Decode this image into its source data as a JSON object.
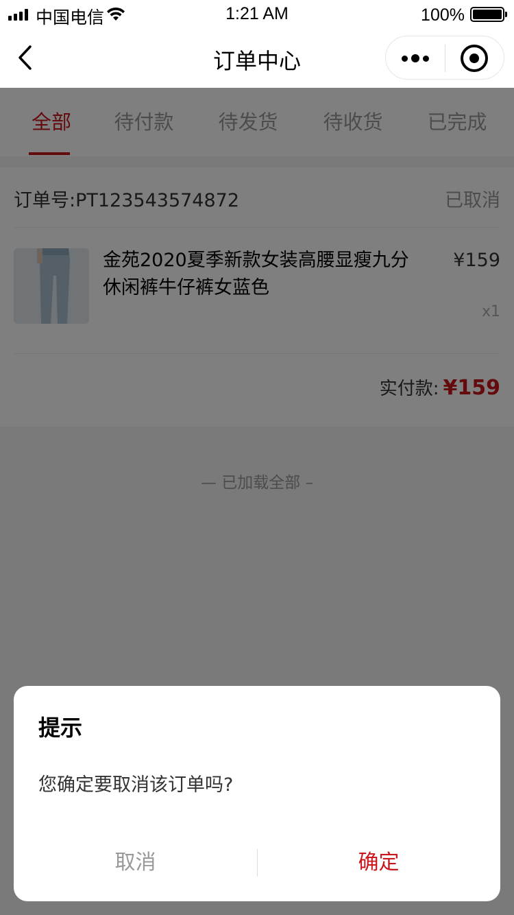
{
  "status_bar": {
    "carrier": "中国电信",
    "time": "1:21 AM",
    "battery": "100%"
  },
  "nav": {
    "title": "订单中心"
  },
  "tabs": [
    {
      "label": "全部",
      "active": true
    },
    {
      "label": "待付款",
      "active": false
    },
    {
      "label": "待发货",
      "active": false
    },
    {
      "label": "待收货",
      "active": false
    },
    {
      "label": "已完成",
      "active": false
    }
  ],
  "order": {
    "number": "订单号:PT123543574872",
    "status": "已取消",
    "product_name": "金苑2020夏季新款女装高腰显瘦九分休闲裤牛仔裤女蓝色",
    "price": "¥159",
    "quantity": "x1",
    "paid_label": "实付款:",
    "paid_value": "¥159"
  },
  "list_footer": "— 已加载全部 –",
  "dialog": {
    "title": "提示",
    "message": "您确定要取消该订单吗?",
    "cancel_label": "取消",
    "confirm_label": "确定"
  },
  "colors": {
    "accent": "#c8161d",
    "mask": "rgba(0,0,0,0.5)"
  }
}
